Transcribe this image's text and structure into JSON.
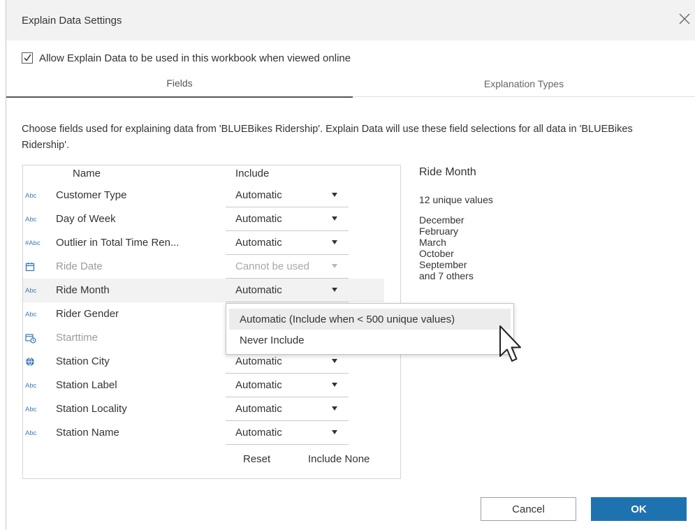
{
  "dialog": {
    "title": "Explain Data Settings",
    "allow_label": "Allow Explain Data to be used in this workbook when viewed online",
    "allow_checked": true
  },
  "tabs": [
    {
      "label": "Fields",
      "selected": true
    },
    {
      "label": "Explanation Types",
      "selected": false
    }
  ],
  "description": "Choose fields used for explaining data from 'BLUEBikes Ridership'. Explain Data will use these field selections for all data in 'BLUEBikes Ridership'.",
  "table": {
    "headers": {
      "name": "Name",
      "include": "Include"
    },
    "rows": [
      {
        "type_icon": "Abc",
        "name": "Customer Type",
        "include": "Automatic"
      },
      {
        "type_icon": "#Abc",
        "name": "Day of Week",
        "include": "Automatic"
      },
      {
        "type_icon": "#Abc",
        "name": "Outlier in Total Time Ren...",
        "include": "Automatic"
      },
      {
        "type_icon": "calendar-icon",
        "name": "Ride Date",
        "include": "Cannot be used"
      },
      {
        "type_icon": "Abc",
        "name": "Ride Month",
        "include": "Automatic"
      },
      {
        "type_icon": "Abc",
        "name": "Rider Gender",
        "include": ""
      },
      {
        "type_icon": "datetime-icon",
        "name": "Starttime",
        "include": ""
      },
      {
        "type_icon": "globe-icon",
        "name": "Station City",
        "include": "Automatic"
      },
      {
        "type_icon": "Abc",
        "name": "Station Label",
        "include": "Automatic"
      },
      {
        "type_icon": "Abc",
        "name": "Station Locality",
        "include": "Automatic"
      },
      {
        "type_icon": "Abc",
        "name": "Station Name",
        "include": "Automatic"
      }
    ],
    "reset_label": "Reset",
    "include_none_label": "Include None"
  },
  "detail": {
    "title": "Ride Month",
    "count": "12 unique values",
    "values": [
      "December",
      "February",
      "March",
      "October",
      "September",
      "and 7 others"
    ]
  },
  "dropdown": {
    "options": [
      "Automatic (Include when < 500 unique values)",
      "Never Include"
    ]
  },
  "buttons": {
    "cancel": "Cancel",
    "ok": "OK"
  },
  "colors": {
    "ok_button": "#1f72b0",
    "type_icon": "#3a7ab8",
    "title_bar": "#f2f2f2"
  }
}
